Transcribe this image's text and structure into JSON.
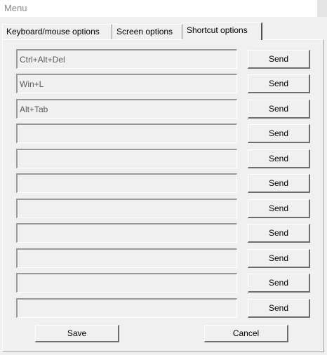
{
  "window": {
    "title": "Menu"
  },
  "tabs": [
    {
      "label": "Keyboard/mouse options",
      "active": false
    },
    {
      "label": "Screen options",
      "active": false
    },
    {
      "label": "Shortcut options",
      "active": true
    }
  ],
  "shortcuts": [
    {
      "value": "Ctrl+Alt+Del",
      "button": "Send"
    },
    {
      "value": "Win+L",
      "button": "Send"
    },
    {
      "value": "Alt+Tab",
      "button": "Send"
    },
    {
      "value": "",
      "button": "Send"
    },
    {
      "value": "",
      "button": "Send"
    },
    {
      "value": "",
      "button": "Send"
    },
    {
      "value": "",
      "button": "Send"
    },
    {
      "value": "",
      "button": "Send"
    },
    {
      "value": "",
      "button": "Send"
    },
    {
      "value": "",
      "button": "Send"
    },
    {
      "value": "",
      "button": "Send"
    }
  ],
  "footer": {
    "save_label": "Save",
    "cancel_label": "Cancel"
  }
}
